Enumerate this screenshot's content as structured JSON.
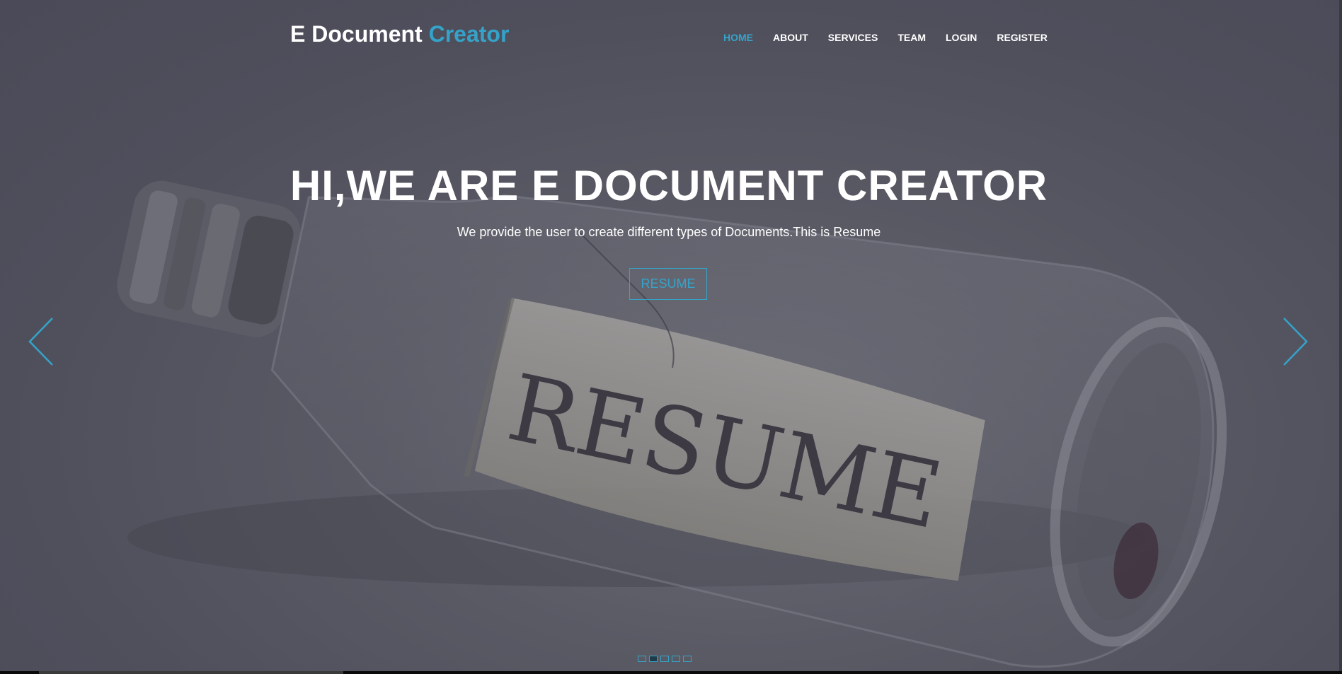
{
  "header": {
    "logo_main": "E Document ",
    "logo_accent": "Creator",
    "nav": [
      {
        "label": "HOME",
        "active": true
      },
      {
        "label": "ABOUT",
        "active": false
      },
      {
        "label": "SERVICES",
        "active": false
      },
      {
        "label": "TEAM",
        "active": false
      },
      {
        "label": "LOGIN",
        "active": false
      },
      {
        "label": "REGISTER",
        "active": false
      }
    ]
  },
  "hero": {
    "title": "HI,WE ARE E DOCUMENT CREATOR",
    "subtitle": "We provide the user to create different types of Documents.This is Resume",
    "button_label": "RESUME",
    "image_text": "RESUME",
    "prev_icon": "chevron-left-icon",
    "next_icon": "chevron-right-icon"
  },
  "carousel": {
    "slide_count": 5,
    "active_index": 1
  },
  "colors": {
    "accent": "#35a3c9",
    "overlay": "#4f4f5c",
    "text": "#ffffff"
  }
}
